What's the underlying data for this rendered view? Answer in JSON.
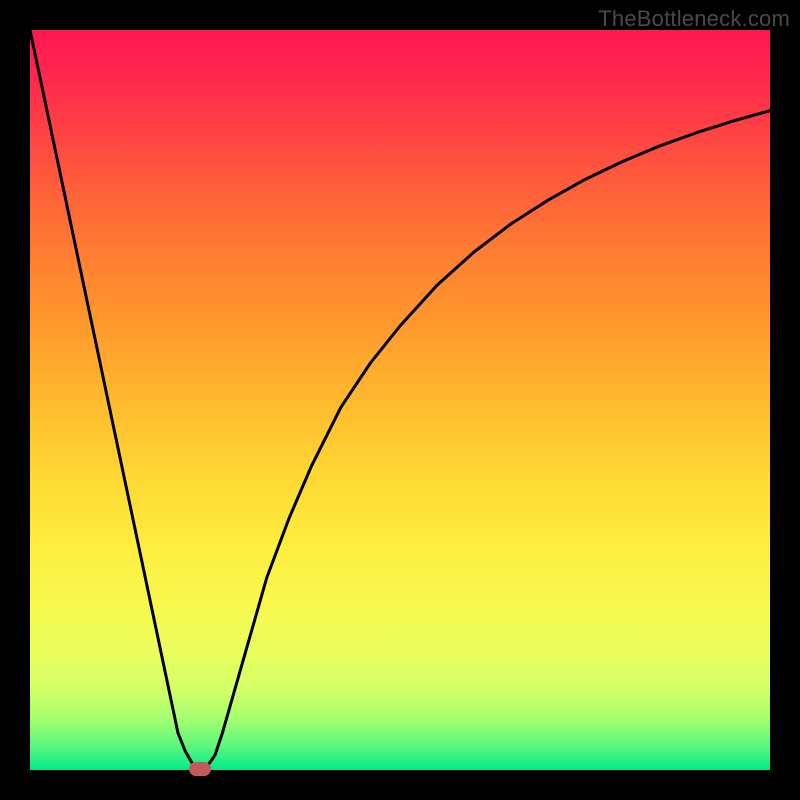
{
  "watermark": "TheBottleneck.com",
  "chart_data": {
    "type": "line",
    "title": "",
    "xlabel": "",
    "ylabel": "",
    "xlim": [
      0,
      100
    ],
    "ylim": [
      0,
      100
    ],
    "background_gradient": {
      "top": "#ff1752",
      "bottom": "#00e98a",
      "stops": [
        "red",
        "orange",
        "yellow",
        "green"
      ]
    },
    "series": [
      {
        "name": "bottleneck-curve",
        "x": [
          0,
          2,
          4,
          6,
          8,
          10,
          12,
          14,
          16,
          18,
          20,
          21,
          22,
          23,
          24,
          25,
          26,
          28,
          30,
          32,
          35,
          38,
          42,
          46,
          50,
          55,
          60,
          65,
          70,
          75,
          80,
          85,
          90,
          95,
          100
        ],
        "y": [
          100,
          90.5,
          81,
          71.5,
          62,
          52.5,
          43,
          33.5,
          24,
          14.5,
          5,
          2.5,
          0.8,
          0.2,
          0.6,
          2.0,
          5.0,
          12,
          19,
          26,
          34,
          41,
          49,
          55,
          60,
          65.5,
          70,
          73.8,
          77,
          79.8,
          82.2,
          84.3,
          86.1,
          87.7,
          89.1
        ]
      }
    ],
    "marker": {
      "name": "optimal-point",
      "x": 23,
      "y": 0.2,
      "color": "#c25a5a"
    }
  }
}
